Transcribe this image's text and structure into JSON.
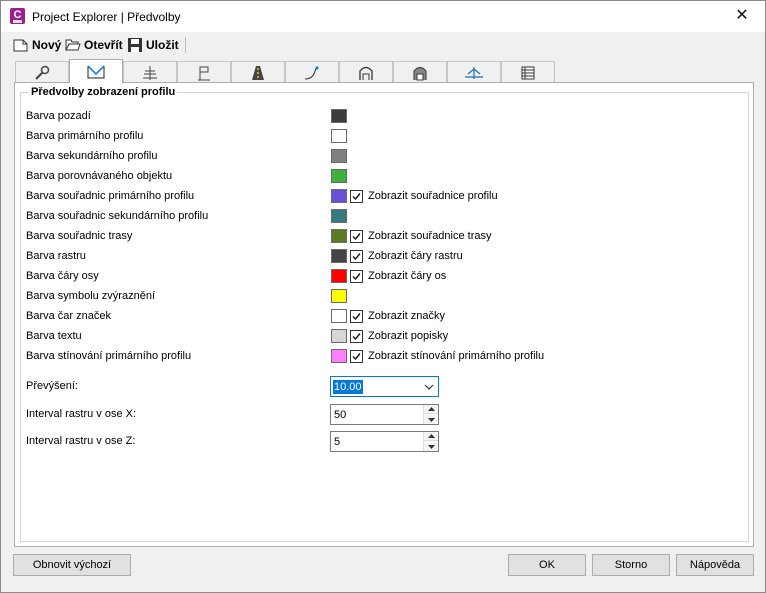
{
  "window": {
    "title": "Project Explorer | Předvolby",
    "app_icon_letter": "C",
    "close_glyph": "✕"
  },
  "toolbar": {
    "new_label": "Nový",
    "open_label": "Otevřít",
    "save_label": "Uložit"
  },
  "tabs": [
    {
      "icon": "wrench-icon",
      "active": false
    },
    {
      "icon": "profile-icon",
      "active": true
    },
    {
      "icon": "cross-section-icon",
      "active": false
    },
    {
      "icon": "flag-icon",
      "active": false
    },
    {
      "icon": "road-icon",
      "active": false
    },
    {
      "icon": "alignment-curve-icon",
      "active": false
    },
    {
      "icon": "tunnel-icon",
      "active": false
    },
    {
      "icon": "tunnel-shaded-icon",
      "active": false
    },
    {
      "icon": "terrain-icon",
      "active": false
    },
    {
      "icon": "table-icon",
      "active": false
    }
  ],
  "group": {
    "title": "Předvolby zobrazení profilu"
  },
  "rows": [
    {
      "label": "Barva pozadí",
      "color": "#3c3c3c"
    },
    {
      "label": "Barva primárního profilu",
      "color": "#ffffff"
    },
    {
      "label": "Barva sekundárního profilu",
      "color": "#7f7f7f"
    },
    {
      "label": "Barva porovnávaného objektu",
      "color": "#3db13d"
    },
    {
      "label": "Barva souřadnic primárního profilu",
      "color": "#6a4fd8",
      "checkbox": {
        "label": "Zobrazit souřadnice profilu",
        "checked": true
      }
    },
    {
      "label": "Barva souřadnic sekundárního profilu",
      "color": "#347a7f"
    },
    {
      "label": "Barva souřadnic trasy",
      "color": "#5a7a23",
      "checkbox": {
        "label": "Zobrazit souřadnice trasy",
        "checked": true
      }
    },
    {
      "label": "Barva rastru",
      "color": "#444444",
      "checkbox": {
        "label": "Zobrazit čáry rastru",
        "checked": true
      }
    },
    {
      "label": "Barva čáry osy",
      "color": "#ff0000",
      "checkbox": {
        "label": "Zobrazit čáry os",
        "checked": true
      }
    },
    {
      "label": "Barva symbolu zvýraznění",
      "color": "#ffff00"
    },
    {
      "label": "Barva čar značek",
      "color": "#ffffff",
      "checkbox": {
        "label": "Zobrazit značky",
        "checked": true
      }
    },
    {
      "label": "Barva textu",
      "color": "#d6d6d6",
      "checkbox": {
        "label": "Zobrazit popisky",
        "checked": true
      }
    },
    {
      "label": "Barva stínování primárního profilu",
      "color": "#ff7fff",
      "checkbox": {
        "label": "Zobrazit stínování primárního profilu",
        "checked": true
      }
    }
  ],
  "fields": {
    "exaggeration_label": "Převýšení:",
    "exaggeration_value": "10.00",
    "grid_x_label": "Interval rastru v ose X:",
    "grid_x_value": "50",
    "grid_z_label": "Interval rastru v ose Z:",
    "grid_z_value": "5"
  },
  "buttons": {
    "reset_label": "Obnovit výchozí",
    "ok_label": "OK",
    "cancel_label": "Storno",
    "help_label": "Nápověda"
  }
}
